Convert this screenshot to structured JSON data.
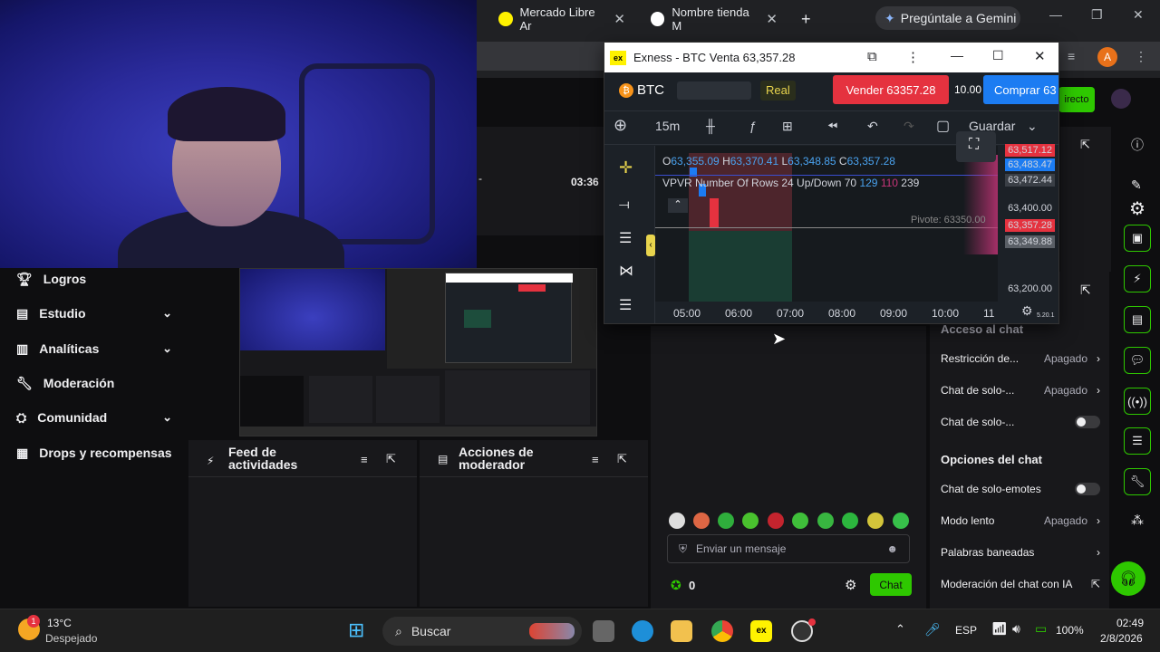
{
  "browser": {
    "tabs": [
      {
        "label": "Mercado Libre Ar"
      },
      {
        "label": "Nombre tienda M"
      }
    ],
    "new_tab": "+",
    "gemini": "Pregúntale a Gemini",
    "avatar_letter": "A"
  },
  "webcam": {},
  "nav": {
    "items": [
      {
        "label": "Logros",
        "chevron": false
      },
      {
        "label": "Estudio",
        "chevron": true
      },
      {
        "label": "Analíticas",
        "chevron": true
      },
      {
        "label": "Moderación",
        "chevron": false
      },
      {
        "label": "Comunidad",
        "chevron": true
      },
      {
        "label": "Drops y recompensas",
        "chevron": false
      }
    ]
  },
  "stream": {
    "timer": "03:36",
    "live_button": "irecto"
  },
  "panels": {
    "activity": {
      "title": "Feed de actividades"
    },
    "mod_actions": {
      "title": "Acciones de moderador"
    }
  },
  "chat": {
    "placeholder": "Enviar un mensaje",
    "points": "0",
    "send_button": "Chat"
  },
  "chat_settings": {
    "access_header": "Acceso al chat",
    "rows": [
      {
        "label": "Restricción de...",
        "value": "Apagado",
        "type": "arrow"
      },
      {
        "label": "Chat de solo-...",
        "value": "Apagado",
        "type": "arrow"
      },
      {
        "label": "Chat de solo-...",
        "value": "",
        "type": "toggle"
      }
    ],
    "options_header": "Opciones del chat",
    "options_rows": [
      {
        "label": "Chat de solo-emotes",
        "value": "",
        "type": "toggle"
      },
      {
        "label": "Modo lento",
        "value": "Apagado",
        "type": "arrow"
      },
      {
        "label": "Palabras baneadas",
        "value": "",
        "type": "arrow"
      },
      {
        "label": "Moderación del chat con IA",
        "value": "",
        "type": "external"
      }
    ]
  },
  "exness": {
    "window_title": "Exness - BTC Venta 63,357.28",
    "symbol": "BTC",
    "account_type": "Real",
    "sell_label": "Vender 63357.28",
    "spread": "10.00",
    "buy_label": "Comprar 63",
    "timeframe": "15m",
    "save_label": "Guardar",
    "ohlc": {
      "o_label": "O",
      "o": "63,355.09",
      "h_label": "H",
      "h": "63,370.41",
      "l_label": "L",
      "l": "63,348.85",
      "c_label": "C",
      "c": "63,357.28"
    },
    "indicator": {
      "name": "VPVR Number Of Rows 24 Up/Down 70",
      "v1": "129",
      "v2": "110",
      "v3": "239"
    },
    "pivot": "Pivote: 63350.00",
    "prices": {
      "p1": "63,517.12",
      "p2": "63,483.47",
      "p3": "63,472.44",
      "p4": "63,400.00",
      "p5": "63,357.28",
      "p6": "63,349.88",
      "p7": "63,200.00"
    },
    "times": [
      "05:00",
      "06:00",
      "07:00",
      "08:00",
      "09:00",
      "10:00",
      "11"
    ],
    "version": "5.20.1",
    "colors": {
      "sell": "#e5323f",
      "buy": "#1c7cf2",
      "brand": "#fff200"
    }
  },
  "taskbar": {
    "weather_temp": "13°C",
    "weather_desc": "Despejado",
    "weather_badge": "1",
    "search": "Buscar",
    "lang": "ESP",
    "battery": "100%",
    "time": "02:49",
    "date": "2/8/2026"
  }
}
